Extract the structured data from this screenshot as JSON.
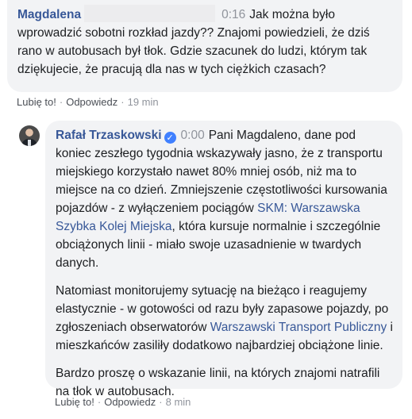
{
  "comment": {
    "author": "Magdalena",
    "timestamp": "0:16",
    "text": "Jak można było wprowadzić sobotni rozkład jazdy?? Znajomi powiedzieli, że dziś rano w autobusach był tłok. Gdzie szacunek do ludzi, którym tak dziękujecie, że pracują dla nas w tych ciężkich czasach?",
    "like_label": "Lubię to!",
    "reply_label": "Odpowiedz",
    "age": "19 min"
  },
  "reply": {
    "author": "Rafał Trzaskowski",
    "verified_glyph": "✓",
    "timestamp": "0:00",
    "p1_a": "Pani Magdaleno, dane pod koniec zeszłego tygodnia wskazywały jasno, że z transportu miejskiego korzystało nawet 80% mniej osób, niż ma to miejsce na co dzień. Zmniejszenie częstotliwości kursowania pojazdów - z wyłączeniem pociągów ",
    "p1_link": "SKM: Warszawska Szybka Kolej Miejska",
    "p1_b": ", która kursuje normalnie i szczególnie obciążonych linii - miało swoje uzasadnienie w twardych danych.",
    "p2_a": "Natomiast monitorujemy sytuację na bieżąco i reagujemy elastycznie - w gotowości od razu były zapasowe pojazdy, po zgłoszeniach obserwatorów ",
    "p2_link": "Warszawski Transport Publiczny",
    "p2_b": " i mieszkańców zasiliły dodatkowo najbardziej obciążone linie.",
    "p3": "Bardzo proszę o wskazanie linii, na których znajomi natrafili na tłok w autobusach.",
    "like_label": "Lubię to!",
    "reply_label": "Odpowiedz",
    "age": "8 min"
  },
  "colors": {
    "bubble": "#f2f3f5",
    "author": "#385898",
    "meta": "#90949c",
    "verified": "#4080ff"
  }
}
